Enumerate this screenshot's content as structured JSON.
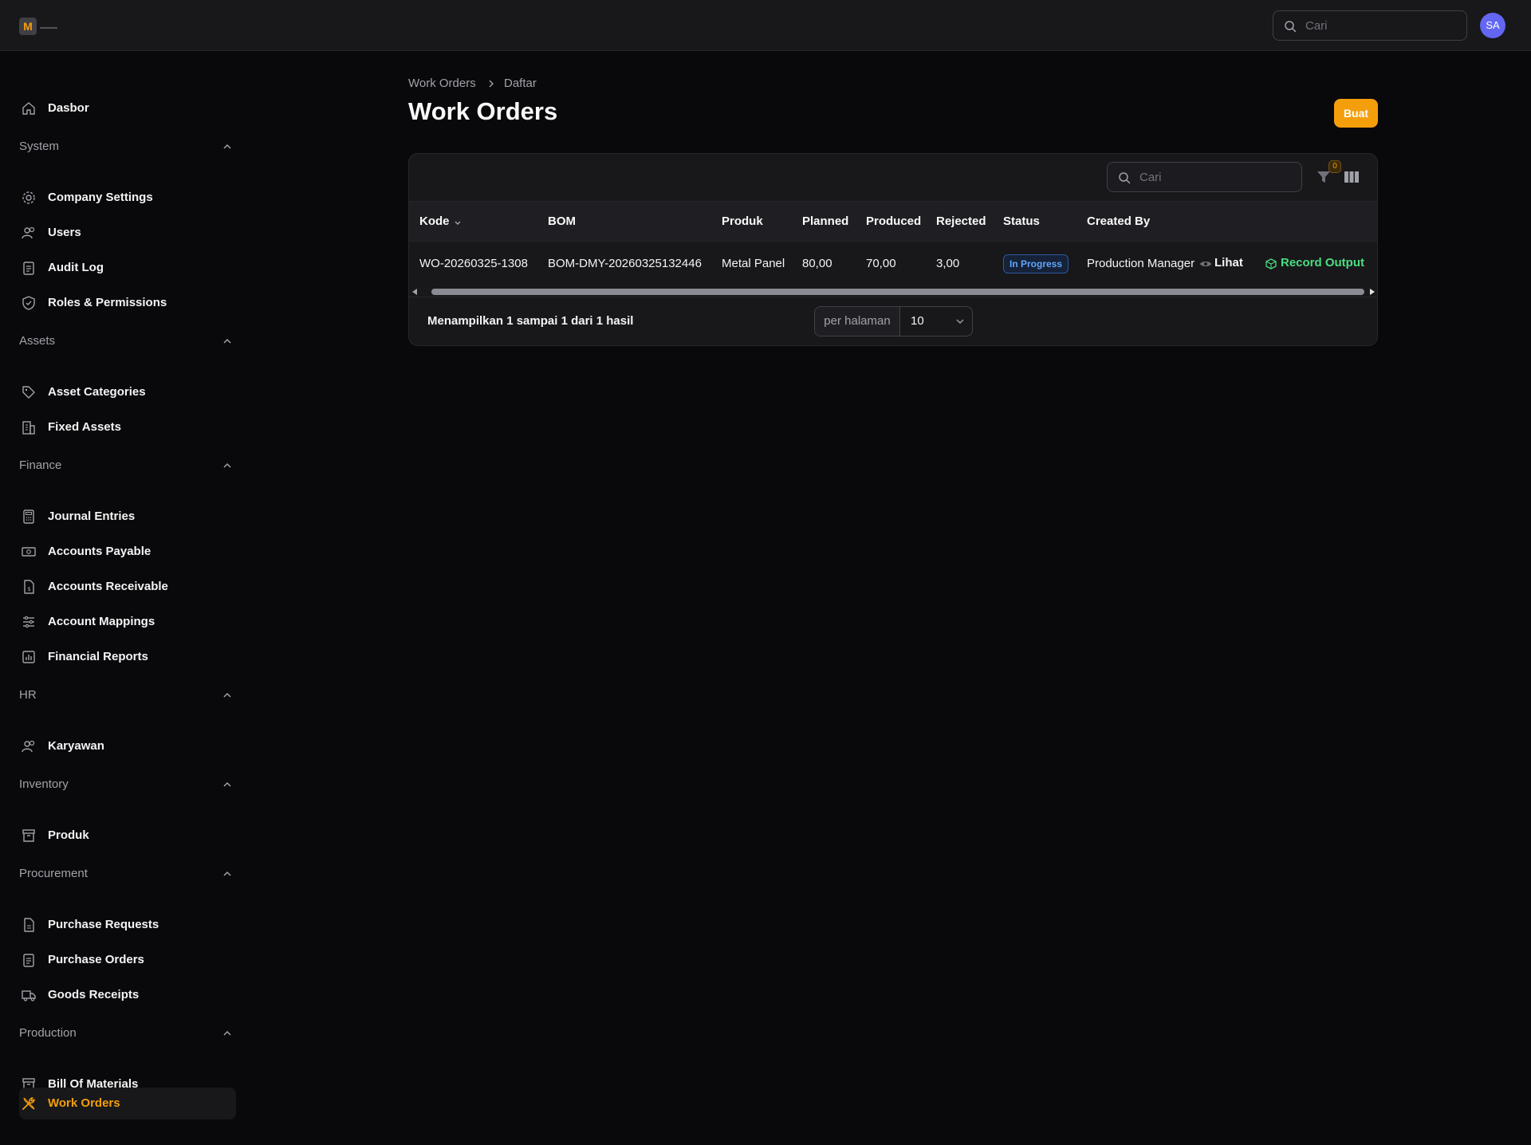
{
  "app": {
    "logo_letter": "M",
    "avatar_initials": "SA"
  },
  "header": {
    "search_placeholder": "Cari"
  },
  "sidebar": {
    "dashboard": "Dasbor",
    "groups": {
      "system": {
        "label": "System",
        "items": [
          "Company Settings",
          "Users",
          "Audit Log",
          "Roles & Permissions"
        ]
      },
      "assets": {
        "label": "Assets",
        "items": [
          "Asset Categories",
          "Fixed Assets"
        ]
      },
      "finance": {
        "label": "Finance",
        "items": [
          "Journal Entries",
          "Accounts Payable",
          "Accounts Receivable",
          "Account Mappings",
          "Financial Reports"
        ]
      },
      "hr": {
        "label": "HR",
        "items": [
          "Karyawan"
        ]
      },
      "inventory": {
        "label": "Inventory",
        "items": [
          "Produk"
        ]
      },
      "procurement": {
        "label": "Procurement",
        "items": [
          "Purchase Requests",
          "Purchase Orders",
          "Goods Receipts"
        ]
      },
      "production": {
        "label": "Production",
        "items": [
          "Bill Of Materials",
          "Work Orders"
        ]
      }
    }
  },
  "breadcrumb": {
    "parent": "Work Orders",
    "current": "Daftar"
  },
  "page": {
    "title": "Work Orders",
    "create_label": "Buat"
  },
  "table": {
    "search_placeholder": "Cari",
    "filter_count": "0",
    "columns": [
      "Kode",
      "BOM",
      "Produk",
      "Planned",
      "Produced",
      "Rejected",
      "Status",
      "Created By"
    ],
    "rows": [
      {
        "kode": "WO-20260325-1308",
        "bom": "BOM-DMY-20260325132446",
        "produk": "Metal Panel",
        "planned": "80,00",
        "produced": "70,00",
        "rejected": "3,00",
        "status": "In Progress",
        "created_by": "Production Manager",
        "action_view": "Lihat",
        "action_record": "Record Output"
      }
    ],
    "footer_text": "Menampilkan 1 sampai 1 dari 1 hasil",
    "per_page_label": "per halaman",
    "per_page_value": "10"
  },
  "colors": {
    "accent": "#f59e0b",
    "status_blue": "#60a5fa",
    "success": "#4ade80",
    "avatar": "#6366f1"
  }
}
